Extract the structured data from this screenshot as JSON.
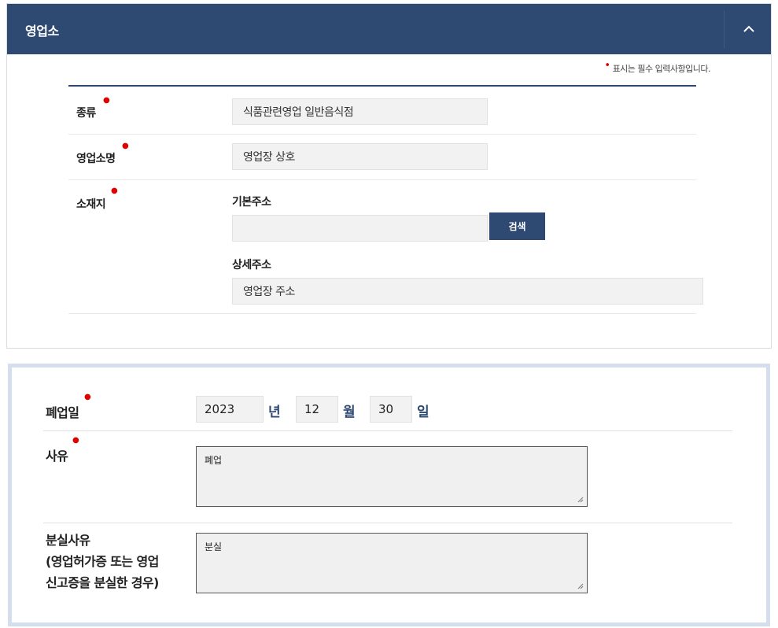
{
  "section1": {
    "title": "영업소",
    "required_note": "표시는 필수 입력사항입니다.",
    "rows": {
      "type": {
        "label": "종류",
        "value": "식품관련영업 일반음식점"
      },
      "name": {
        "label": "영업소명",
        "value": "영업장 상호"
      },
      "location": {
        "label": "소재지",
        "basic_address_label": "기본주소",
        "basic_address_value": "",
        "search_button": "검색",
        "detail_address_label": "상세주소",
        "detail_address_value": "영업장 주소"
      }
    }
  },
  "section2": {
    "closure_date": {
      "label": "폐업일",
      "year": "2023",
      "year_unit": "년",
      "month": "12",
      "month_unit": "월",
      "day": "30",
      "day_unit": "일"
    },
    "reason": {
      "label": "사유",
      "value": "폐업"
    },
    "loss_reason": {
      "label_line1": "분실사유",
      "label_line2": "(영업허가증 또는 영업",
      "label_line3": "신고증을 분실한 경우)",
      "value": "분실"
    }
  },
  "colors": {
    "header_bg": "#2f4a72",
    "required_marker": "#e00000",
    "section2_border": "#d5deec"
  },
  "icons": {
    "collapse": "chevron-up-icon",
    "resize": "resize-grip-icon"
  }
}
